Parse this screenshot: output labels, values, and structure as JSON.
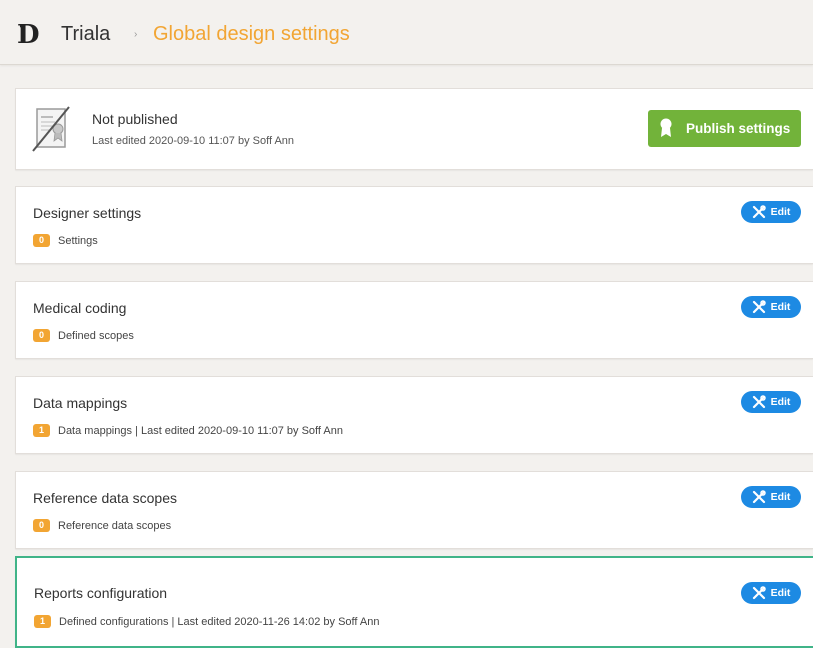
{
  "header": {
    "logo": "D",
    "app_name": "Triala",
    "separator": "›",
    "current_page": "Global design settings"
  },
  "publish": {
    "status": "Not published",
    "last_edited": "Last edited 2020-09-10 11:07 by Soff Ann",
    "button_label": "Publish settings"
  },
  "sections": [
    {
      "title": "Designer settings",
      "count": "0",
      "meta": "Settings",
      "edit_label": "Edit"
    },
    {
      "title": "Medical coding",
      "count": "0",
      "meta": "Defined scopes",
      "edit_label": "Edit"
    },
    {
      "title": "Data mappings",
      "count": "1",
      "meta": "Data mappings | Last edited 2020-09-10 11:07 by Soff Ann",
      "edit_label": "Edit"
    },
    {
      "title": "Reference data scopes",
      "count": "0",
      "meta": "Reference data scopes",
      "edit_label": "Edit"
    },
    {
      "title": "Reports configuration",
      "count": "1",
      "meta": "Defined configurations | Last edited 2020-11-26 14:02 by Soff Ann",
      "edit_label": "Edit"
    }
  ],
  "colors": {
    "accent_orange": "#f2a533",
    "publish_green": "#72b33a",
    "edit_blue": "#1d8ae3",
    "highlight_border": "#40b488"
  },
  "icons": {
    "publish_status": "unpublished-certificate-icon",
    "publish_button": "ribbon-icon",
    "edit": "tools-icon"
  }
}
